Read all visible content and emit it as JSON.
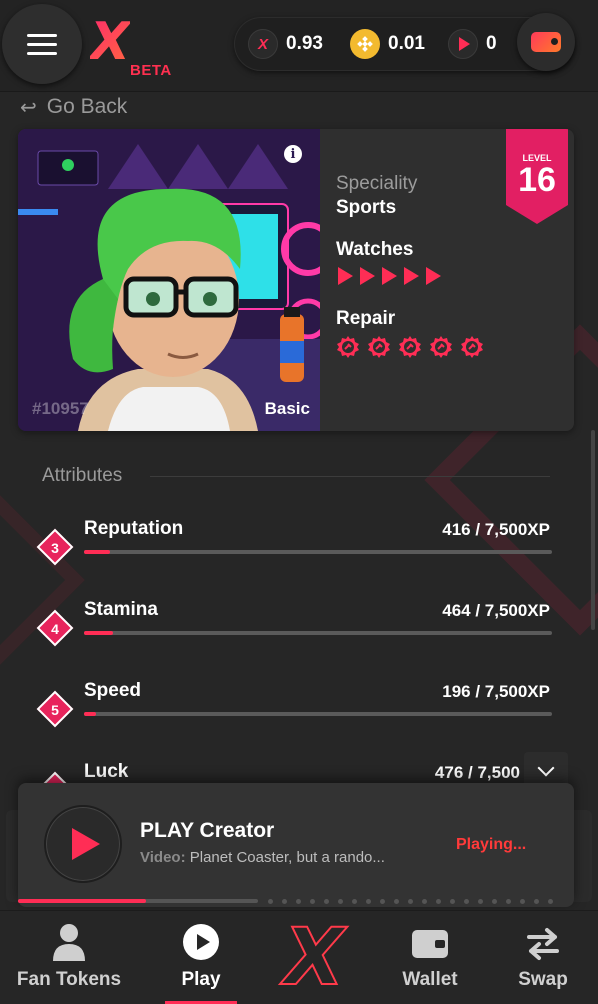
{
  "header": {
    "logo_letter": "X",
    "logo_badge": "BETA",
    "balances": [
      {
        "icon": "x-token-icon",
        "value": "0.93"
      },
      {
        "icon": "bnb-coin-icon",
        "value": "0.01"
      },
      {
        "icon": "play-token-icon",
        "value": "0"
      }
    ]
  },
  "nav_back": {
    "label": "Go Back"
  },
  "card": {
    "token_id": "#10957",
    "tier": "Basic",
    "level_label": "LEVEL",
    "level": "16",
    "speciality_label": "Speciality",
    "speciality": "Sports",
    "watches_label": "Watches",
    "watches_count": 5,
    "repair_label": "Repair",
    "repair_count": 5
  },
  "attributes": {
    "title": "Attributes",
    "items": [
      {
        "name": "Reputation",
        "level": "3",
        "xp": "416 / 7,500XP",
        "progress": 0.055
      },
      {
        "name": "Stamina",
        "level": "4",
        "xp": "464 / 7,500XP",
        "progress": 0.062
      },
      {
        "name": "Speed",
        "level": "5",
        "xp": "196 / 7,500XP",
        "progress": 0.026
      },
      {
        "name": "Luck",
        "level": "",
        "xp": "476 / 7,500",
        "progress": 0.063
      }
    ]
  },
  "player": {
    "title": "PLAY Creator",
    "video_label": "Video:",
    "video_title": "Planet Coaster, but a rando...",
    "status": "Playing...",
    "progress": 0.23
  },
  "bottom_nav": {
    "items": [
      {
        "label": "Fan Tokens",
        "icon": "user-icon"
      },
      {
        "label": "Play",
        "icon": "play-icon"
      },
      {
        "label": "",
        "icon": "x-logo-icon"
      },
      {
        "label": "Wallet",
        "icon": "wallet-icon"
      },
      {
        "label": "Swap",
        "icon": "swap-icon"
      }
    ],
    "active": "Play"
  },
  "colors": {
    "accent": "#ff2d55",
    "level_badge": "#e21f63",
    "background": "#262626",
    "bnb": "#f3ba2f"
  }
}
